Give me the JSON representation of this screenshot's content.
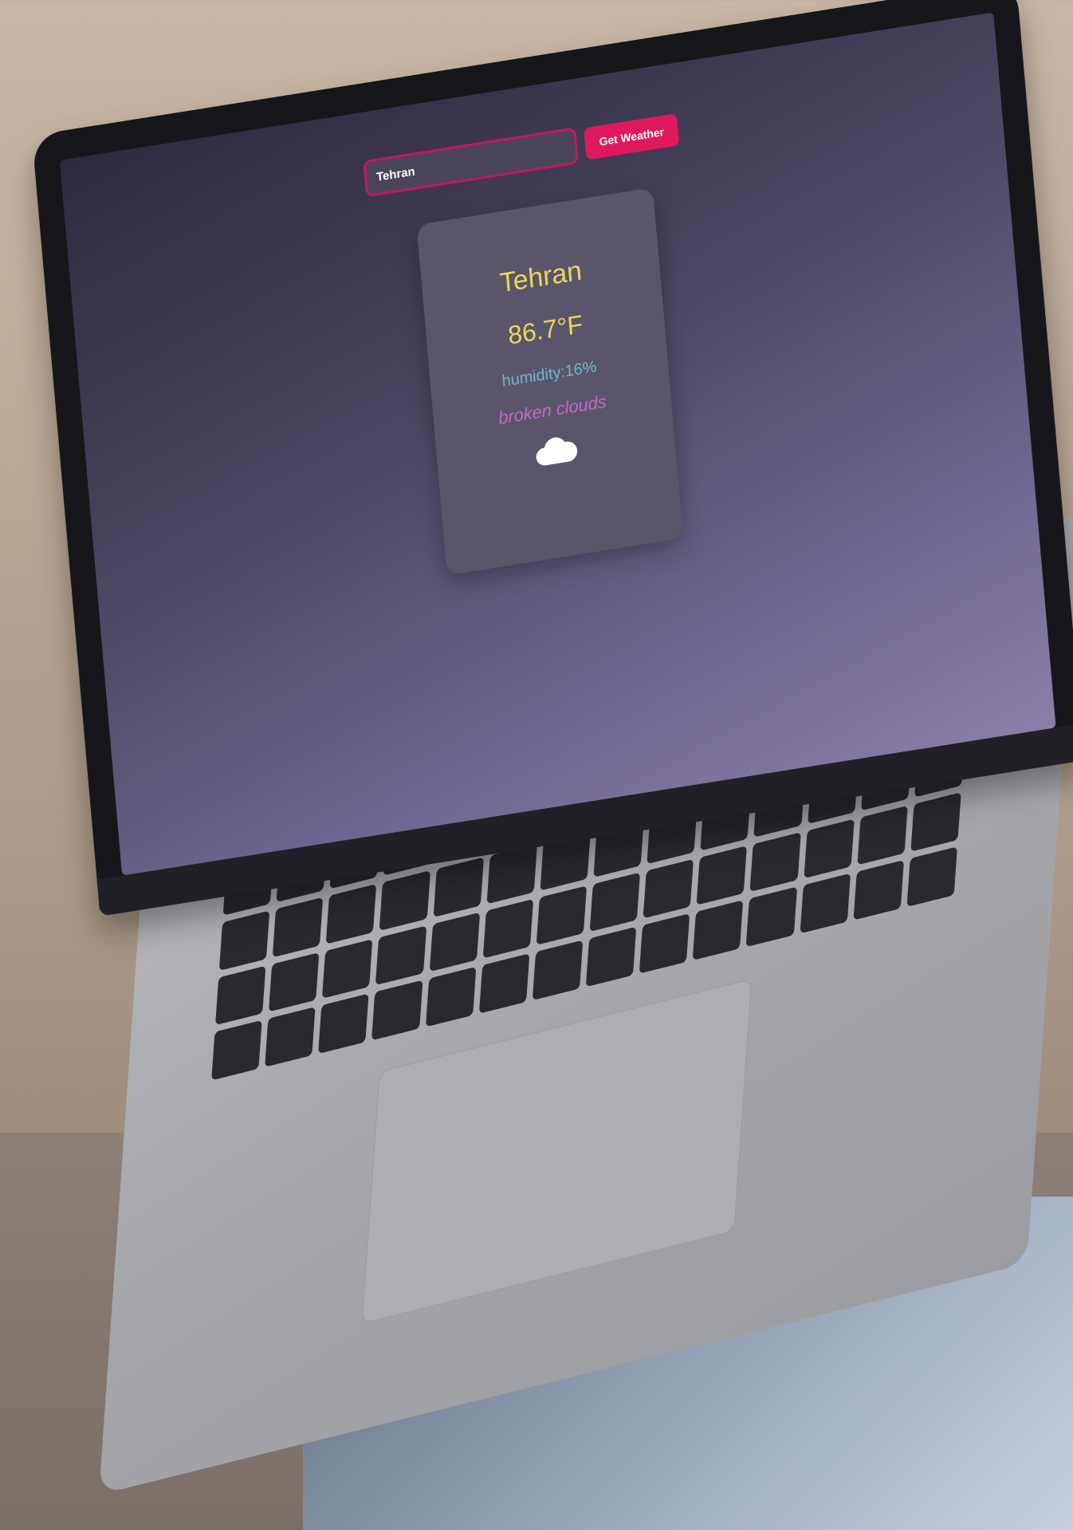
{
  "app": {
    "search": {
      "value": "Tehran",
      "placeholder": ""
    },
    "button_label": "Get Weather",
    "weather": {
      "city": "Tehran",
      "temperature": "86.7°F",
      "humidity": "humidity:16%",
      "description": "broken clouds",
      "icon": "cloud-icon"
    }
  },
  "colors": {
    "accent": "#e0195e",
    "city_text": "#e8d85a",
    "humidity_text": "#6fb7c8",
    "description_text": "#c06ac8",
    "card_bg": "#5b556b"
  }
}
